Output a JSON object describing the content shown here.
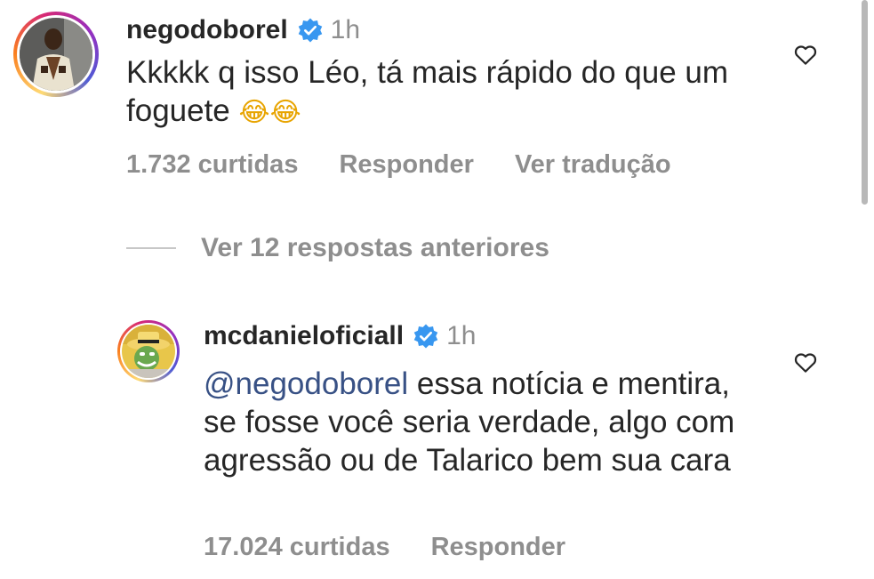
{
  "comments": [
    {
      "username": "negodoborel",
      "time": "1h",
      "text": "Kkkkk q isso Léo, tá mais rápido do que um foguete",
      "emoji": "😂😂",
      "likes": "1.732 curtidas",
      "reply_label": "Responder",
      "translate_label": "Ver tradução"
    },
    {
      "username": "mcdanieloficiall",
      "time": "1h",
      "mention": "@negodoborel",
      "text": " essa notícia e mentira, se fosse você seria verdade, algo com agressão ou de Talarico bem sua cara",
      "likes": "17.024 curtidas",
      "reply_label": "Responder"
    }
  ],
  "view_replies_label": "Ver 12 respostas anteriores",
  "colors": {
    "verified": "#3897f0",
    "mention": "#385185",
    "muted": "#8e8e8e"
  },
  "icons": [
    "verified-badge-icon",
    "heart-icon"
  ]
}
